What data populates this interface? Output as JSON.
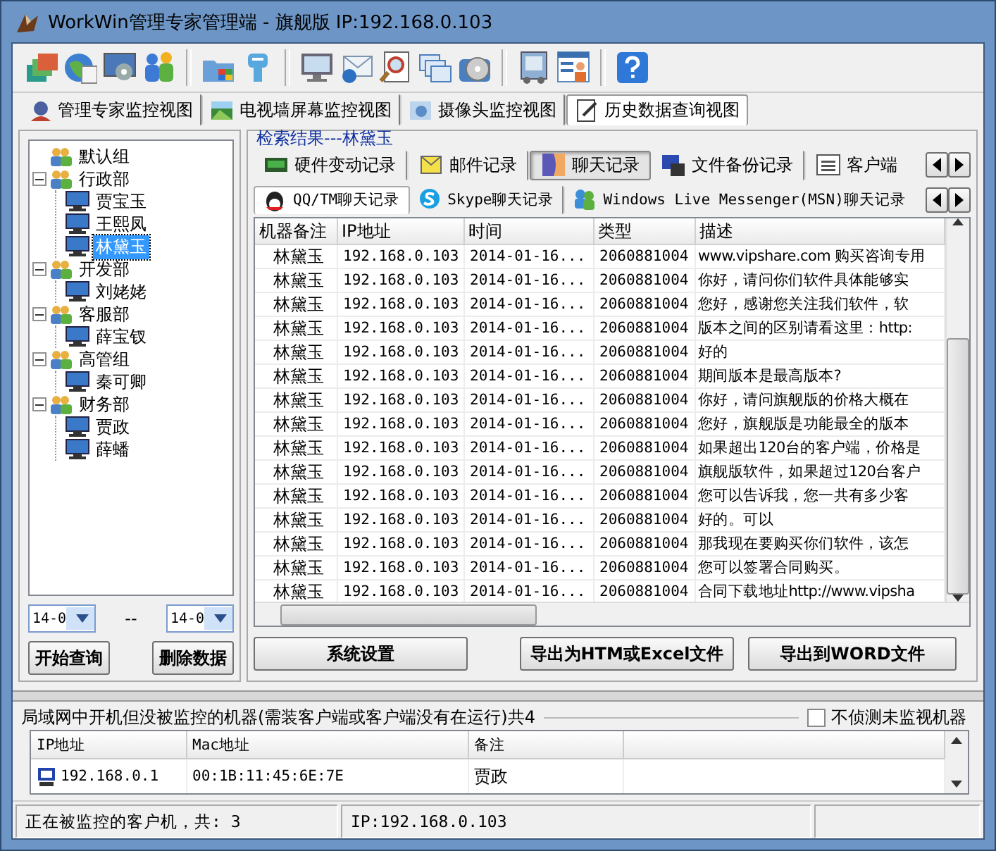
{
  "window": {
    "title": "WorkWin管理专家管理端 - 旗舰版 IP:192.168.0.103"
  },
  "view_tabs": [
    {
      "label": "管理专家监控视图",
      "selected": false
    },
    {
      "label": "电视墙屏幕监控视图",
      "selected": false
    },
    {
      "label": "摄像头监控视图",
      "selected": false
    },
    {
      "label": "历史数据查询视图",
      "selected": true
    }
  ],
  "tree": [
    {
      "label": "默认组",
      "selected": false
    },
    {
      "label": "行政部",
      "selected": false,
      "expanded": true,
      "children": [
        {
          "label": "贾宝玉",
          "selected": false
        },
        {
          "label": "王熙凤",
          "selected": false
        },
        {
          "label": "林黛玉",
          "selected": true
        }
      ]
    },
    {
      "label": "开发部",
      "selected": false,
      "expanded": true,
      "children": [
        {
          "label": "刘姥姥",
          "selected": false
        }
      ]
    },
    {
      "label": "客服部",
      "selected": false,
      "expanded": true,
      "children": [
        {
          "label": "薛宝钗",
          "selected": false
        }
      ]
    },
    {
      "label": "高管组",
      "selected": false,
      "expanded": true,
      "children": [
        {
          "label": "秦可卿",
          "selected": false
        }
      ]
    },
    {
      "label": "财务部",
      "selected": false,
      "expanded": true,
      "children": [
        {
          "label": "贾政",
          "selected": false
        },
        {
          "label": "薛蟠",
          "selected": false
        }
      ]
    }
  ],
  "date_from": "14-0",
  "date_separator": "--",
  "date_to": "14-0",
  "left_buttons": [
    "开始查询",
    "删除数据"
  ],
  "result_title": "检索结果---林黛玉",
  "record_tabs": [
    {
      "label": "硬件变动记录",
      "selected": false
    },
    {
      "label": "邮件记录",
      "selected": false
    },
    {
      "label": "聊天记录",
      "selected": true
    },
    {
      "label": "文件备份记录",
      "selected": false
    },
    {
      "label": "客户端",
      "selected": false
    }
  ],
  "chat_tabs": [
    {
      "label": "QQ/TM聊天记录",
      "selected": true
    },
    {
      "label": "Skype聊天记录",
      "selected": false
    },
    {
      "label": "Windows Live Messenger(MSN)聊天记录",
      "selected": false
    }
  ],
  "table": {
    "columns": [
      "机器备注",
      "IP地址",
      "时间",
      "类型",
      "描述"
    ],
    "rows": [
      [
        "林黛玉",
        "192.168.0.103",
        "2014-01-16...",
        "2060881004",
        "www.vipshare.com 购买咨询专用"
      ],
      [
        "林黛玉",
        "192.168.0.103",
        "2014-01-16...",
        "2060881004",
        "你好，请问你们软件具体能够实"
      ],
      [
        "林黛玉",
        "192.168.0.103",
        "2014-01-16...",
        "2060881004",
        "您好，感谢您关注我们软件，软"
      ],
      [
        "林黛玉",
        "192.168.0.103",
        "2014-01-16...",
        "2060881004",
        "版本之间的区别请看这里：http:"
      ],
      [
        "林黛玉",
        "192.168.0.103",
        "2014-01-16...",
        "2060881004",
        "好的"
      ],
      [
        "林黛玉",
        "192.168.0.103",
        "2014-01-16...",
        "2060881004",
        "期间版本是最高版本?"
      ],
      [
        "林黛玉",
        "192.168.0.103",
        "2014-01-16...",
        "2060881004",
        "你好，请问旗舰版的价格大概在"
      ],
      [
        "林黛玉",
        "192.168.0.103",
        "2014-01-16...",
        "2060881004",
        "您好，旗舰版是功能最全的版本"
      ],
      [
        "林黛玉",
        "192.168.0.103",
        "2014-01-16...",
        "2060881004",
        "如果超出120台的客户端，价格是"
      ],
      [
        "林黛玉",
        "192.168.0.103",
        "2014-01-16...",
        "2060881004",
        "旗舰版软件，如果超过120台客户"
      ],
      [
        "林黛玉",
        "192.168.0.103",
        "2014-01-16...",
        "2060881004",
        "您可以告诉我，您一共有多少客"
      ],
      [
        "林黛玉",
        "192.168.0.103",
        "2014-01-16...",
        "2060881004",
        "好的。可以"
      ],
      [
        "林黛玉",
        "192.168.0.103",
        "2014-01-16...",
        "2060881004",
        "那我现在要购买你们软件，该怎"
      ],
      [
        "林黛玉",
        "192.168.0.103",
        "2014-01-16...",
        "2060881004",
        "您可以签署合同购买。"
      ],
      [
        "林黛玉",
        "192.168.0.103",
        "2014-01-16...",
        "2060881004",
        "合同下载地址http://www.vipsha"
      ]
    ]
  },
  "bottom_buttons": [
    "系统设置",
    "导出为HTM或Excel文件",
    "导出到WORD文件"
  ],
  "lan_panel": {
    "title": "局域网中开机但没被监控的机器(需装客户端或客户端没有在运行)共4",
    "checkbox": {
      "label": "不侦测未监视机器",
      "checked": false
    },
    "columns": [
      "IP地址",
      "Mac地址",
      "备注"
    ],
    "rows": [
      [
        "192.168.0.1",
        "00:1B:11:45:6E:7E",
        "贾政"
      ]
    ]
  },
  "status_bar": [
    "正在被监控的客户机，共: 3",
    "IP:192.168.0.103"
  ]
}
